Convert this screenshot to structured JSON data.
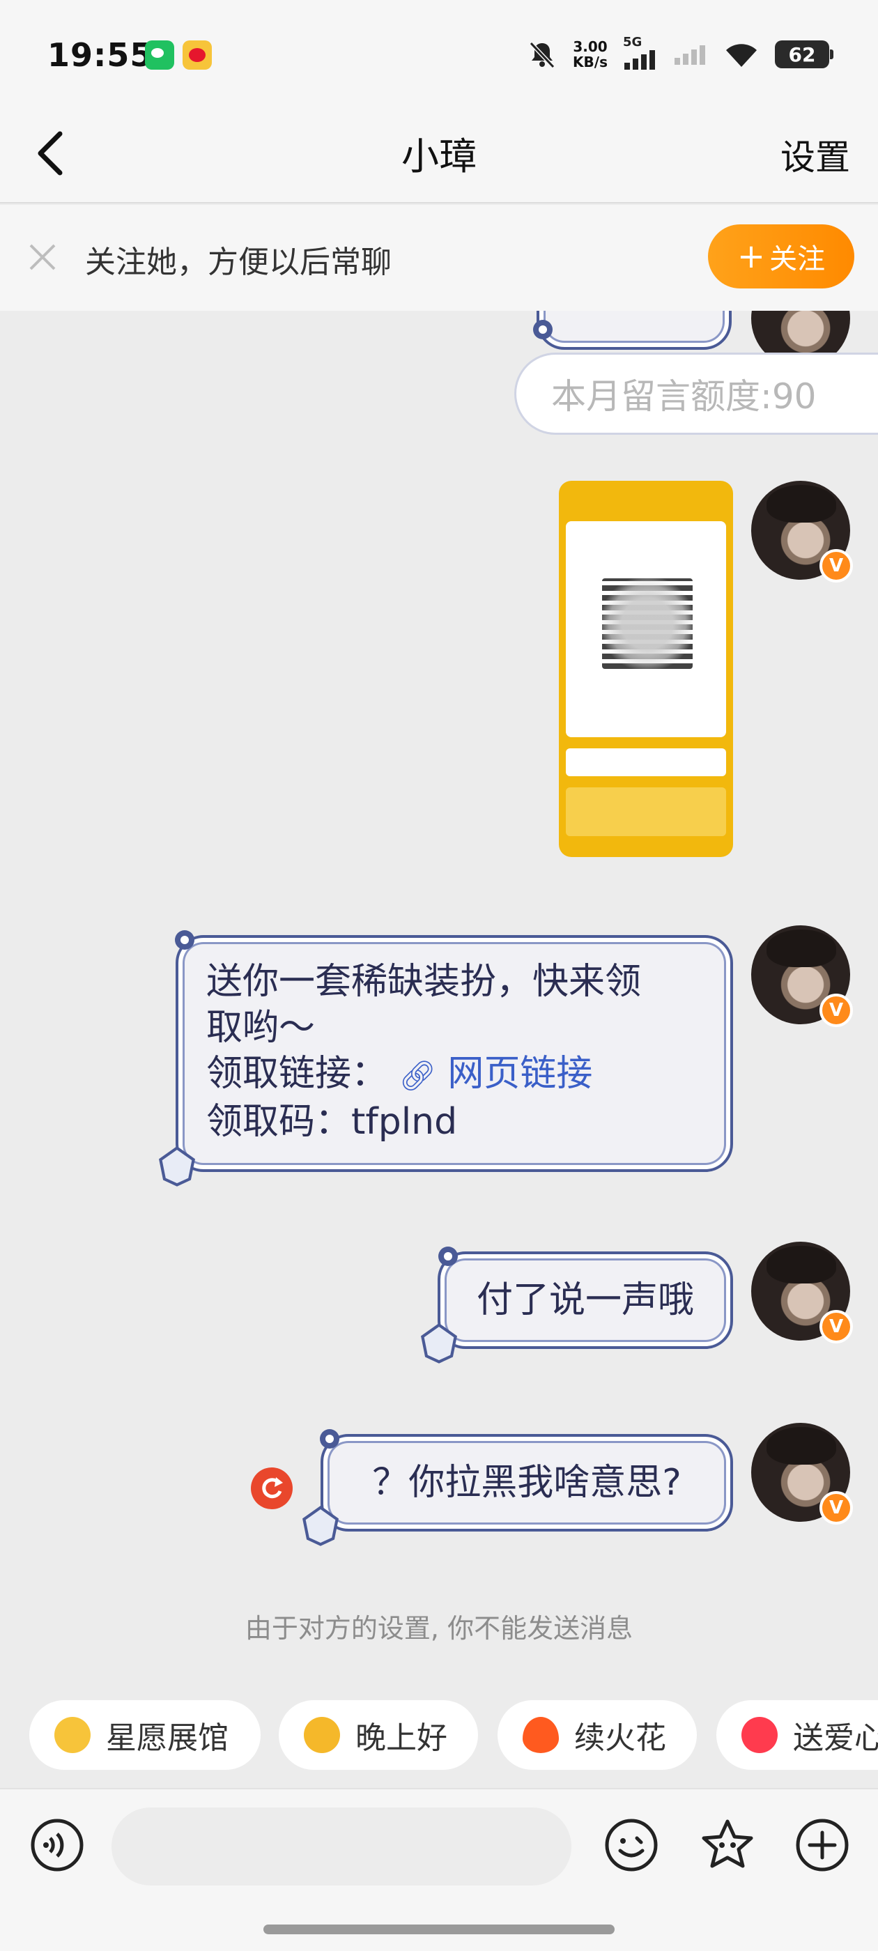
{
  "status_bar": {
    "time": "19:55",
    "net_speed_value": "3.00",
    "net_speed_unit": "KB/s",
    "network": "5G",
    "battery": "62"
  },
  "header": {
    "title": "小璋",
    "settings_label": "设置"
  },
  "follow_banner": {
    "text": "关注她，方便以后常聊",
    "button_label": "关注",
    "button_plus": "+"
  },
  "messages": {
    "quota": "本月留言额度:90",
    "gift": {
      "line1": "送你一套稀缺装扮，快来领",
      "line2": "取哟～",
      "link_prefix": "领取链接：",
      "link_text": "网页链接",
      "code_line": "领取码：tfplnd"
    },
    "pay": "付了说一声哦",
    "blocked": "？你拉黑我啥意思?"
  },
  "notice": "由于对方的设置, 你不能发送消息",
  "chips": [
    {
      "label": "星愿展馆",
      "icon": "star-face-icon",
      "color": "#f7c43a"
    },
    {
      "label": "晚上好",
      "icon": "star-smile-icon",
      "color": "#f5b82a"
    },
    {
      "label": "续火花",
      "icon": "fire-icon",
      "color": "#ff5a1f"
    },
    {
      "label": "送爱心",
      "icon": "heart-icon",
      "color": "#ff3b4e"
    }
  ],
  "colors": {
    "accent_orange": "#ff8a00",
    "bubble_border": "#4a5a96",
    "link_blue": "#3a5fc8",
    "retry_red": "#e9472c"
  }
}
